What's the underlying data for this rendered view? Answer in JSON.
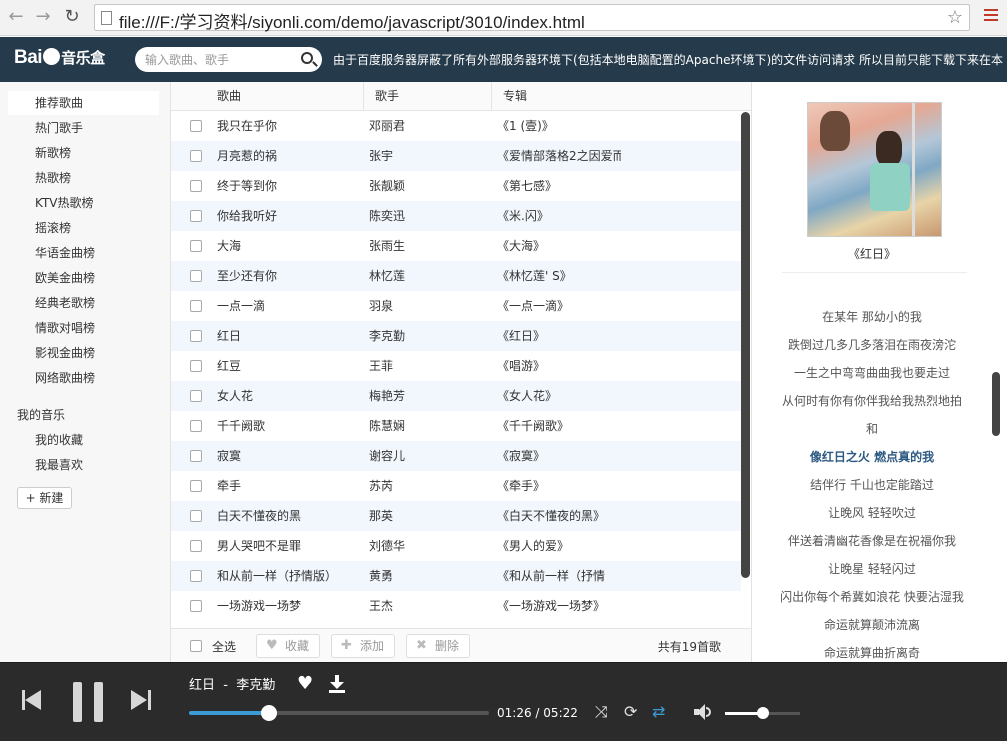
{
  "browser": {
    "url": "file:///F:/学习资料/siyonli.com/demo/javascript/3010/index.html",
    "back_icon": "back-arrow-icon",
    "forward_icon": "forward-arrow-icon",
    "reload_icon": "reload-icon",
    "bookmark_icon": "star-icon",
    "menu_icon": "hamburger-menu-icon"
  },
  "header": {
    "logo_prefix": "Bai",
    "logo_suffix": "音乐盒",
    "search_placeholder": "输入歌曲、歌手",
    "notice": "由于百度服务器屏蔽了所有外部服务器环境下(包括本地电脑配置的Apache环境下)的文件访问请求 所以目前只能下载下来在本"
  },
  "sidebar": {
    "items": [
      "推荐歌曲",
      "热门歌手",
      "新歌榜",
      "热歌榜",
      "KTV热歌榜",
      "摇滚榜",
      "华语金曲榜",
      "欧美金曲榜",
      "经典老歌榜",
      "情歌对唱榜",
      "影视金曲榜",
      "网络歌曲榜"
    ],
    "my_music_title": "我的音乐",
    "my_music": [
      "我的收藏",
      "我最喜欢"
    ],
    "new_label": "+ 新建"
  },
  "list": {
    "headers": {
      "song": "歌曲",
      "artist": "歌手",
      "album": "专辑"
    },
    "rows": [
      {
        "song": "我只在乎你",
        "artist": "邓丽君",
        "album": "《1 (壹)》"
      },
      {
        "song": "月亮惹的祸",
        "artist": "张宇",
        "album": "《爱情部落格2之因爱而"
      },
      {
        "song": "终于等到你",
        "artist": "张靓颖",
        "album": "《第七感》"
      },
      {
        "song": "你给我听好",
        "artist": "陈奕迅",
        "album": "《米.闪》"
      },
      {
        "song": "大海",
        "artist": "张雨生",
        "album": "《大海》"
      },
      {
        "song": "至少还有你",
        "artist": "林忆莲",
        "album": "《林忆莲' S》"
      },
      {
        "song": "一点一滴",
        "artist": "羽泉",
        "album": "《一点一滴》"
      },
      {
        "song": "红日",
        "artist": "李克勤",
        "album": "《红日》"
      },
      {
        "song": "红豆",
        "artist": "王菲",
        "album": "《唱游》"
      },
      {
        "song": "女人花",
        "artist": "梅艳芳",
        "album": "《女人花》"
      },
      {
        "song": "千千阙歌",
        "artist": "陈慧娴",
        "album": "《千千阙歌》"
      },
      {
        "song": "寂寞",
        "artist": "谢容儿",
        "album": "《寂寞》"
      },
      {
        "song": "牵手",
        "artist": "苏芮",
        "album": "《牵手》"
      },
      {
        "song": "白天不懂夜的黑",
        "artist": "那英",
        "album": "《白天不懂夜的黑》"
      },
      {
        "song": "男人哭吧不是罪",
        "artist": "刘德华",
        "album": "《男人的爱》"
      },
      {
        "song": "和从前一样（抒情版）",
        "artist": "黄勇",
        "album": "《和从前一样（抒情"
      },
      {
        "song": "一场游戏一场梦",
        "artist": "王杰",
        "album": "《一场游戏一场梦》"
      }
    ],
    "footer": {
      "select_all": "全选",
      "collect": "收藏",
      "add": "添加",
      "delete": "删除",
      "count": "共有19首歌"
    }
  },
  "right": {
    "album": "《红日》",
    "lyrics": [
      "在某年 那幼小的我",
      "跌倒过几多几多落泪在雨夜滂沱",
      "一生之中弯弯曲曲我也要走过",
      "从何时有你有你伴我给我热烈地拍",
      "和",
      "像红日之火 燃点真的我",
      "结伴行 千山也定能踏过",
      "让晚风 轻轻吹过",
      "伴送着清幽花香像是在祝福你我",
      "让晚星 轻轻闪过",
      "闪出你每个希冀如浪花 快要沾湿我",
      "命运就算颠沛流离",
      "命运就算曲折离奇"
    ],
    "current_lyric_index": 5
  },
  "player": {
    "title": "红日",
    "separator": "-",
    "artist": "李克勤",
    "current_time": "01:26",
    "total_time": "05:22",
    "time_separator": "/",
    "progress_fraction": 0.267,
    "volume_fraction": 0.5,
    "accent": "#3a9bd6",
    "icons": [
      "prev-icon",
      "pause-icon",
      "next-icon",
      "heart-icon",
      "download-icon",
      "shuffle-icon",
      "repeat-icon",
      "loop-icon",
      "volume-icon"
    ]
  }
}
